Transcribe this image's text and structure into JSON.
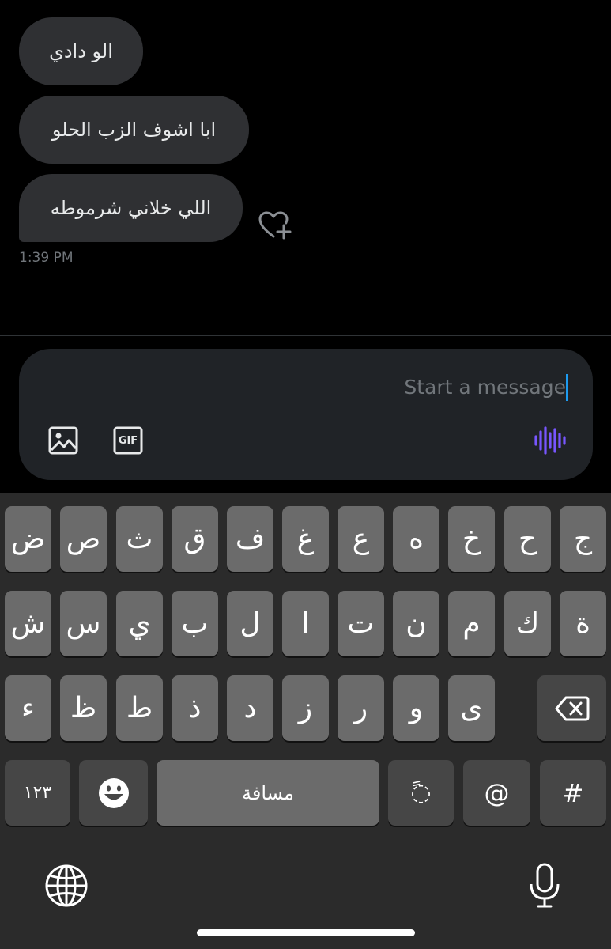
{
  "messages": [
    {
      "text": "الو دادي"
    },
    {
      "text": "ابا اشوف الزب الحلو"
    },
    {
      "text": "اللي خلاني شرموطه"
    }
  ],
  "timestamp": "1:39 PM",
  "composer": {
    "placeholder": "Start a message",
    "icons": [
      "image-icon",
      "gif-icon",
      "voice-message-icon"
    ],
    "gif_label": "GIF",
    "accent_color": "#1d9bf0",
    "voice_color": "#7856ff"
  },
  "keyboard": {
    "row1": [
      "ض",
      "ص",
      "ث",
      "ق",
      "ف",
      "غ",
      "ع",
      "ه",
      "خ",
      "ح",
      "ج"
    ],
    "row2": [
      "ش",
      "س",
      "ي",
      "ب",
      "ل",
      "ا",
      "ت",
      "ن",
      "م",
      "ك",
      "ة"
    ],
    "row3": [
      "ء",
      "ظ",
      "ط",
      "ذ",
      "د",
      "ز",
      "ر",
      "و",
      "ى"
    ],
    "numbers_label": "١٢٣",
    "space_label": "مسافة",
    "tanween_label": "◌ً",
    "at_label": "@",
    "hash_label": "#",
    "icons": [
      "backspace-icon",
      "emoji-icon",
      "globe-icon",
      "microphone-icon"
    ]
  }
}
